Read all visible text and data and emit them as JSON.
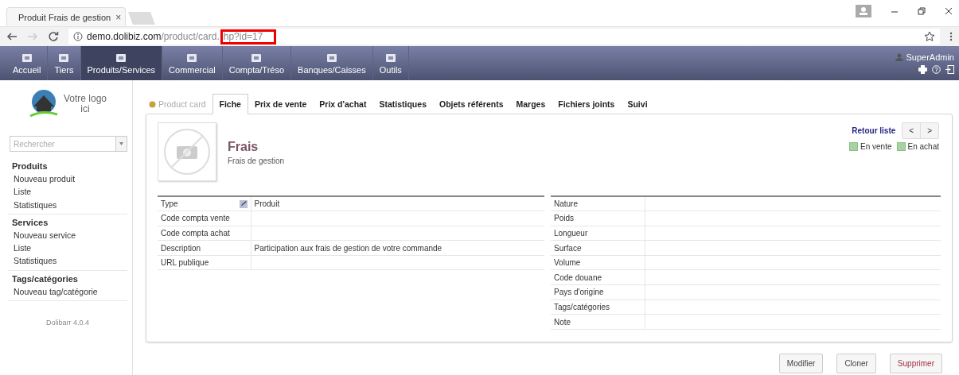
{
  "browser": {
    "tab_title": "Produit Frais de gestion",
    "tab_close": "×",
    "url_host": "demo.dolibiz.com",
    "url_path": "/product/card.",
    "url_highlighted": "hp?id=17"
  },
  "topnav": {
    "items": [
      {
        "label": "Accueil",
        "selected": false
      },
      {
        "label": "Tiers",
        "selected": false
      },
      {
        "label": "Produits/Services",
        "selected": true
      },
      {
        "label": "Commercial",
        "selected": false
      },
      {
        "label": "Compta/Tréso",
        "selected": false
      },
      {
        "label": "Banques/Caisses",
        "selected": false
      },
      {
        "label": "Outils",
        "selected": false
      }
    ],
    "user": "SuperAdmin"
  },
  "sidebar": {
    "logo_text": [
      "Votre logo",
      "ici"
    ],
    "search": {
      "placeholder": "Rechercher"
    },
    "sections": [
      {
        "title": "Produits",
        "items": [
          "Nouveau produit",
          "Liste",
          "Statistiques"
        ]
      },
      {
        "title": "Services",
        "items": [
          "Nouveau service",
          "Liste",
          "Statistiques"
        ]
      },
      {
        "title": "Tags/catégories",
        "items": [
          "Nouveau tag/catégorie"
        ]
      }
    ],
    "version": "Dolibarr 4.0.4"
  },
  "tabs_head": "Product card",
  "tabs": [
    {
      "label": "Fiche",
      "selected": true
    },
    {
      "label": "Prix de vente",
      "selected": false
    },
    {
      "label": "Prix d'achat",
      "selected": false
    },
    {
      "label": "Statistiques",
      "selected": false
    },
    {
      "label": "Objets référents",
      "selected": false
    },
    {
      "label": "Marges",
      "selected": false
    },
    {
      "label": "Fichiers joints",
      "selected": false
    },
    {
      "label": "Suivi",
      "selected": false
    }
  ],
  "product": {
    "ref": "Frais",
    "label": "Frais de gestion",
    "back_link": "Retour liste",
    "prev": "<",
    "next": ">",
    "statuses": [
      {
        "label": "En vente",
        "on": true
      },
      {
        "label": "En achat",
        "on": true
      }
    ]
  },
  "left_table": [
    {
      "label": "Type",
      "value": "Produit",
      "editable": true
    },
    {
      "label": "Code compta vente",
      "editable": false
    },
    {
      "label": "Code compta achat",
      "editable": false
    },
    {
      "label": "Description",
      "value": "Participation aux frais de gestion de votre commande",
      "editable": false
    },
    {
      "label": "URL publique",
      "editable": false
    }
  ],
  "right_table": [
    {
      "label": "Nature"
    },
    {
      "label": "Poids"
    },
    {
      "label": "Longueur"
    },
    {
      "label": "Surface"
    },
    {
      "label": "Volume"
    },
    {
      "label": "Code douane"
    },
    {
      "label": "Pays d'origine"
    },
    {
      "label": "Tags/catégories"
    },
    {
      "label": "Note"
    }
  ],
  "actions": [
    {
      "label": "Modifier",
      "kind": "normal"
    },
    {
      "label": "Cloner",
      "kind": "normal"
    },
    {
      "label": "Supprimer",
      "kind": "danger"
    }
  ]
}
